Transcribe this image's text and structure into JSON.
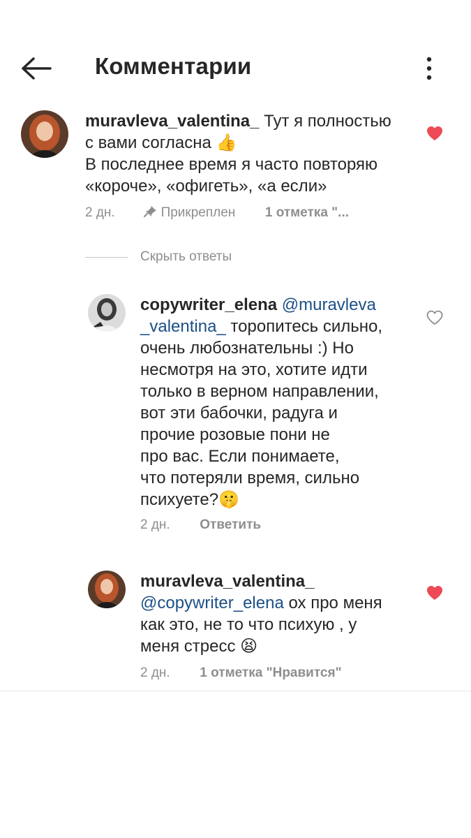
{
  "header": {
    "title": "Комментарии"
  },
  "comments": [
    {
      "username": "muravleva_valentina_",
      "text_line1_rest": "Тут я полностью",
      "text_line2": "с вами согласна",
      "text_line3": "В последнее время я часто повторяю",
      "text_line4": "«короче», «офигеть», «а если»",
      "emoji": "👍",
      "time": "2 дн.",
      "pinned": "Прикреплен",
      "likes": "1 отметка \"...",
      "liked": true
    }
  ],
  "hide_replies": "Скрыть ответы",
  "replies": [
    {
      "username": "copywriter_elena",
      "mention_part1": "@muravleva",
      "mention_part2": "_valentina_",
      "text_line2_rest": " торопитесь сильно,",
      "text_lines": [
        "очень любознательны :) Но",
        "несмотря на это, хотите идти",
        "только в верном направлении,",
        "вот эти бабочки, радуга и",
        "прочие розовые пони не",
        "про вас. Если понимаете,",
        "что потеряли время, сильно"
      ],
      "last_line": "психуете?",
      "emoji": "🤫",
      "time": "2 дн.",
      "reply": "Ответить",
      "liked": false
    },
    {
      "username": "muravleva_valentina_",
      "mention": "@copywriter_elena",
      "text_line2_rest": " ох про меня",
      "text_line3": "как это, не то что психую , у",
      "text_line4": "меня стресс",
      "emoji": "😫",
      "time": "2 дн.",
      "likes": "1 отметка \"Нравится\"",
      "liked": true
    }
  ],
  "colors": {
    "heart_liked": "#ed4956",
    "mention": "#1c4f86",
    "meta": "#8e8e8e"
  },
  "icons": [
    "back-arrow-icon",
    "more-vertical-icon",
    "pin-icon",
    "heart-icon"
  ]
}
